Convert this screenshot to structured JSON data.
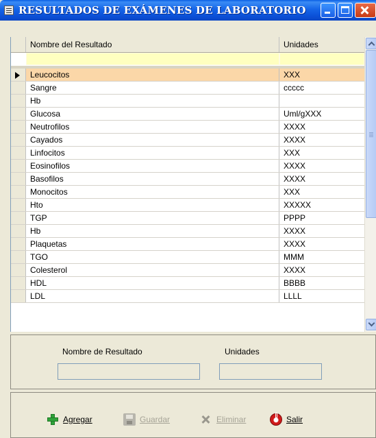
{
  "window": {
    "title": "RESULTADOS DE EXÁMENES DE LABORATORIO"
  },
  "grid": {
    "columns": [
      "Nombre del Resultado",
      "Unidades"
    ],
    "selected_index": 0,
    "rows": [
      {
        "name": "Leucocitos",
        "unit": "XXX"
      },
      {
        "name": "Sangre",
        "unit": "ccccc"
      },
      {
        "name": "Hb",
        "unit": ""
      },
      {
        "name": "Glucosa",
        "unit": "Uml/gXXX"
      },
      {
        "name": "Neutrofilos",
        "unit": "XXXX"
      },
      {
        "name": "Cayados",
        "unit": "XXXX"
      },
      {
        "name": "Linfocitos",
        "unit": "XXX"
      },
      {
        "name": "Eosinofilos",
        "unit": "XXXX"
      },
      {
        "name": "Basofilos",
        "unit": "XXXX"
      },
      {
        "name": "Monocitos",
        "unit": "XXX"
      },
      {
        "name": "Hto",
        "unit": "XXXXX"
      },
      {
        "name": "TGP",
        "unit": "PPPP"
      },
      {
        "name": "Hb",
        "unit": "XXXX"
      },
      {
        "name": "Plaquetas",
        "unit": "XXXX"
      },
      {
        "name": "TGO",
        "unit": "MMM"
      },
      {
        "name": "Colesterol",
        "unit": "XXXX"
      },
      {
        "name": "HDL",
        "unit": "BBBB"
      },
      {
        "name": "LDL",
        "unit": "LLLL"
      }
    ]
  },
  "form": {
    "name_label": "Nombre de Resultado",
    "name_value": "",
    "units_label": "Unidades",
    "units_value": ""
  },
  "actions": {
    "add": "Agregar",
    "save": "Guardar",
    "delete": "Eliminar",
    "exit": "Salir"
  },
  "colors": {
    "title_bar": "#0b4fd6",
    "selected_row": "#fbd7a8",
    "filter_row": "#ffffc0",
    "window_bg": "#ece9d8"
  },
  "icons": {
    "window": "window-icon",
    "add": "plus-icon",
    "save": "save-icon",
    "delete": "delete-x-icon",
    "exit": "power-exit-icon"
  }
}
